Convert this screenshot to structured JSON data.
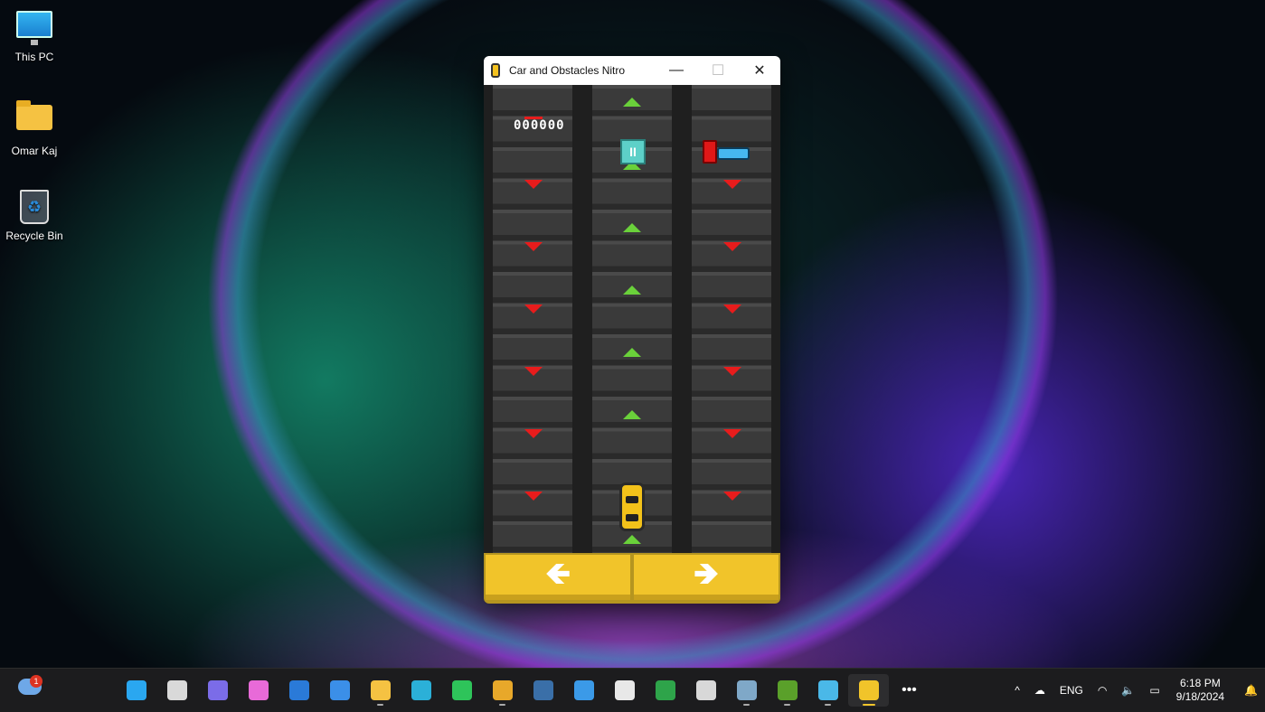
{
  "desktop": {
    "icons": [
      {
        "label": "This PC"
      },
      {
        "label": "Omar Kaj"
      },
      {
        "label": "Recycle Bin"
      }
    ]
  },
  "window": {
    "title": "Car and Obstacles Nitro",
    "minimize_glyph": "—",
    "maximize_glyph": "☐",
    "close_glyph": "✕"
  },
  "game": {
    "score": "000000",
    "pause_glyph": "II",
    "left_control_glyph": "🡸",
    "right_control_glyph": "🡺"
  },
  "taskbar": {
    "weather_badge": "1",
    "apps": [
      {
        "name": "start-button-icon",
        "color": "#2aa7f0"
      },
      {
        "name": "task-view-icon",
        "color": "#d9d9d9"
      },
      {
        "name": "teams-icon",
        "color": "#7b6ce8"
      },
      {
        "name": "copilot-icon",
        "color": "#e86ad8"
      },
      {
        "name": "outlook-icon",
        "color": "#2a7ad8"
      },
      {
        "name": "todo-icon",
        "color": "#3b8fe8"
      },
      {
        "name": "file-explorer-icon",
        "color": "#f5c242"
      },
      {
        "name": "edge-icon",
        "color": "#2bb0d8"
      },
      {
        "name": "whatsapp-icon",
        "color": "#2ec45a"
      },
      {
        "name": "chrome-icon",
        "color": "#e8a82a"
      },
      {
        "name": "steam-icon",
        "color": "#3a6fa8"
      },
      {
        "name": "remote-desktop-icon",
        "color": "#3b9ae8"
      },
      {
        "name": "store-icon",
        "color": "#e8e8e8"
      },
      {
        "name": "game-pass-icon",
        "color": "#2ea44a"
      },
      {
        "name": "settings-ring-icon",
        "color": "#d8d8d8"
      },
      {
        "name": "keyboard-app-icon",
        "color": "#7fa8c8"
      },
      {
        "name": "dreamweaver-icon",
        "color": "#5aa02a"
      },
      {
        "name": "notepad-icon",
        "color": "#4ab8e8"
      },
      {
        "name": "car-game-icon",
        "color": "#f1c42a"
      }
    ],
    "overflow_glyph": "•••",
    "tray": {
      "chevron": "^",
      "language": "ENG",
      "time": "6:18 PM",
      "date": "9/18/2024"
    }
  }
}
